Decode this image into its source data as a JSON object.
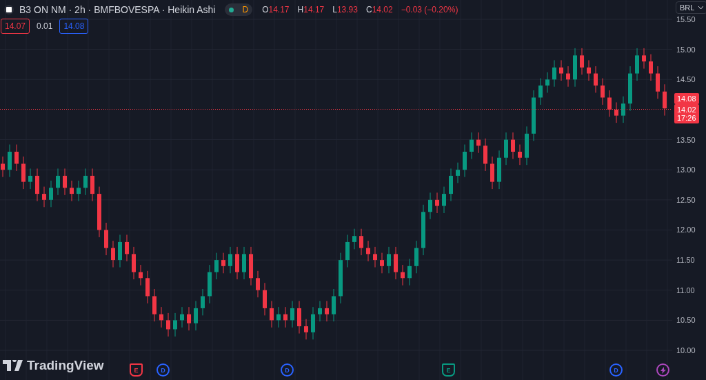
{
  "header": {
    "title": "B3 ON NM · 2h · BMFBOVESPA · Heikin Ashi",
    "timeframe_badge": "D",
    "ohlc": [
      {
        "label": "O",
        "value": "14.17"
      },
      {
        "label": "H",
        "value": "14.17"
      },
      {
        "label": "L",
        "value": "13.93"
      },
      {
        "label": "C",
        "value": "14.02"
      }
    ],
    "change": "−0.03 (−0.20%)"
  },
  "quote": {
    "bid": "14.07",
    "spread": "0.01",
    "ask": "14.08"
  },
  "currency": "BRL",
  "price_axis": {
    "ask_label": "14.08",
    "last_price": "14.02",
    "countdown": "17:26"
  },
  "chart_data": {
    "type": "candlestick",
    "ylim": [
      10,
      15.5
    ],
    "grid": true,
    "yticks": [
      {
        "value": 10,
        "label": "10.00"
      },
      {
        "value": 10.5,
        "label": "10.50"
      },
      {
        "value": 11,
        "label": "11.00"
      },
      {
        "value": 11.5,
        "label": "11.50"
      },
      {
        "value": 12,
        "label": "12.00"
      },
      {
        "value": 12.5,
        "label": "12.50"
      },
      {
        "value": 13,
        "label": "13.00"
      },
      {
        "value": 13.5,
        "label": "13.50"
      },
      {
        "value": 14.5,
        "label": "14.50"
      },
      {
        "value": 15,
        "label": "15.00"
      },
      {
        "value": 15.5,
        "label": "15.50"
      }
    ],
    "ohlc": [
      [
        13.1,
        13.22,
        12.88,
        13.0
      ],
      [
        13.0,
        13.42,
        12.88,
        13.3
      ],
      [
        13.3,
        13.42,
        12.98,
        13.1
      ],
      [
        13.1,
        13.22,
        12.68,
        12.8
      ],
      [
        12.8,
        13.02,
        12.68,
        12.9
      ],
      [
        12.9,
        13.02,
        12.48,
        12.6
      ],
      [
        12.6,
        12.72,
        12.38,
        12.5
      ],
      [
        12.5,
        12.82,
        12.38,
        12.7
      ],
      [
        12.7,
        13.02,
        12.58,
        12.9
      ],
      [
        12.9,
        13.02,
        12.58,
        12.7
      ],
      [
        12.7,
        12.82,
        12.48,
        12.6
      ],
      [
        12.6,
        12.82,
        12.48,
        12.7
      ],
      [
        12.7,
        13.02,
        12.58,
        12.9
      ],
      [
        12.9,
        13.02,
        12.48,
        12.6
      ],
      [
        12.6,
        12.72,
        11.88,
        12.0
      ],
      [
        12.0,
        12.12,
        11.58,
        11.7
      ],
      [
        11.7,
        11.82,
        11.38,
        11.5
      ],
      [
        11.5,
        11.92,
        11.38,
        11.8
      ],
      [
        11.8,
        11.92,
        11.48,
        11.6
      ],
      [
        11.6,
        11.72,
        11.18,
        11.3
      ],
      [
        11.3,
        11.42,
        11.08,
        11.2
      ],
      [
        11.2,
        11.32,
        10.78,
        10.9
      ],
      [
        10.9,
        11.02,
        10.48,
        10.6
      ],
      [
        10.6,
        10.72,
        10.38,
        10.5
      ],
      [
        10.5,
        10.62,
        10.23,
        10.35
      ],
      [
        10.35,
        10.62,
        10.23,
        10.5
      ],
      [
        10.5,
        10.72,
        10.38,
        10.6
      ],
      [
        10.6,
        10.72,
        10.33,
        10.45
      ],
      [
        10.45,
        10.82,
        10.33,
        10.7
      ],
      [
        10.7,
        11.02,
        10.58,
        10.9
      ],
      [
        10.9,
        11.42,
        10.78,
        11.3
      ],
      [
        11.3,
        11.62,
        11.18,
        11.5
      ],
      [
        11.5,
        11.62,
        11.28,
        11.4
      ],
      [
        11.4,
        11.72,
        11.28,
        11.6
      ],
      [
        11.6,
        11.72,
        11.18,
        11.3
      ],
      [
        11.3,
        11.72,
        11.18,
        11.6
      ],
      [
        11.6,
        11.72,
        11.08,
        11.2
      ],
      [
        11.2,
        11.32,
        10.88,
        11.0
      ],
      [
        11.0,
        11.12,
        10.58,
        10.7
      ],
      [
        10.7,
        10.82,
        10.38,
        10.5
      ],
      [
        10.5,
        10.72,
        10.38,
        10.6
      ],
      [
        10.6,
        10.72,
        10.38,
        10.5
      ],
      [
        10.5,
        10.82,
        10.38,
        10.7
      ],
      [
        10.7,
        10.82,
        10.28,
        10.4
      ],
      [
        10.4,
        10.52,
        10.18,
        10.3
      ],
      [
        10.3,
        10.72,
        10.18,
        10.6
      ],
      [
        10.6,
        10.82,
        10.48,
        10.7
      ],
      [
        10.7,
        10.82,
        10.48,
        10.6
      ],
      [
        10.6,
        11.02,
        10.48,
        10.9
      ],
      [
        10.9,
        11.62,
        10.78,
        11.5
      ],
      [
        11.5,
        11.92,
        11.38,
        11.8
      ],
      [
        11.8,
        12.02,
        11.68,
        11.9
      ],
      [
        11.9,
        12.02,
        11.58,
        11.7
      ],
      [
        11.7,
        11.82,
        11.48,
        11.6
      ],
      [
        11.6,
        11.72,
        11.38,
        11.5
      ],
      [
        11.5,
        11.62,
        11.28,
        11.4
      ],
      [
        11.4,
        11.72,
        11.28,
        11.6
      ],
      [
        11.6,
        11.72,
        11.18,
        11.3
      ],
      [
        11.3,
        11.42,
        11.08,
        11.2
      ],
      [
        11.2,
        11.52,
        11.08,
        11.4
      ],
      [
        11.4,
        11.82,
        11.28,
        11.7
      ],
      [
        11.7,
        12.42,
        11.58,
        12.3
      ],
      [
        12.3,
        12.62,
        12.18,
        12.5
      ],
      [
        12.5,
        12.62,
        12.28,
        12.4
      ],
      [
        12.4,
        12.72,
        12.28,
        12.6
      ],
      [
        12.6,
        13.02,
        12.48,
        12.9
      ],
      [
        12.9,
        13.12,
        12.78,
        13.0
      ],
      [
        13.0,
        13.42,
        12.88,
        13.3
      ],
      [
        13.3,
        13.62,
        13.18,
        13.5
      ],
      [
        13.5,
        13.62,
        13.28,
        13.4
      ],
      [
        13.4,
        13.52,
        12.98,
        13.1
      ],
      [
        13.1,
        13.22,
        12.68,
        12.8
      ],
      [
        12.8,
        13.32,
        12.68,
        13.2
      ],
      [
        13.2,
        13.62,
        13.08,
        13.5
      ],
      [
        13.5,
        13.62,
        13.18,
        13.3
      ],
      [
        13.3,
        13.42,
        13.08,
        13.2
      ],
      [
        13.2,
        13.72,
        13.08,
        13.6
      ],
      [
        13.6,
        14.32,
        13.48,
        14.2
      ],
      [
        14.2,
        14.52,
        14.08,
        14.4
      ],
      [
        14.4,
        14.62,
        14.28,
        14.5
      ],
      [
        14.5,
        14.82,
        14.38,
        14.7
      ],
      [
        14.7,
        14.82,
        14.48,
        14.6
      ],
      [
        14.6,
        14.72,
        14.38,
        14.5
      ],
      [
        14.5,
        15.02,
        14.38,
        14.9
      ],
      [
        14.9,
        15.02,
        14.58,
        14.7
      ],
      [
        14.7,
        14.82,
        14.48,
        14.6
      ],
      [
        14.6,
        14.72,
        14.28,
        14.4
      ],
      [
        14.4,
        14.52,
        14.08,
        14.2
      ],
      [
        14.2,
        14.32,
        13.88,
        14.0
      ],
      [
        14.0,
        14.12,
        13.78,
        13.9
      ],
      [
        13.9,
        14.22,
        13.78,
        14.1
      ],
      [
        14.1,
        14.72,
        13.98,
        14.6
      ],
      [
        14.6,
        15.02,
        14.48,
        14.9
      ],
      [
        14.9,
        15.02,
        14.68,
        14.8
      ],
      [
        14.8,
        14.92,
        14.48,
        14.6
      ],
      [
        14.6,
        14.72,
        14.18,
        14.3
      ],
      [
        14.3,
        14.42,
        13.9,
        14.02
      ]
    ]
  },
  "events": [
    {
      "kind": "earnings",
      "label": "E",
      "color": "#f23645"
    },
    {
      "kind": "dividend",
      "label": "D",
      "color": "#2962ff"
    },
    {
      "kind": "dividend",
      "label": "D",
      "color": "#2962ff"
    },
    {
      "kind": "earnings",
      "label": "E",
      "color": "#089981"
    },
    {
      "kind": "dividend",
      "label": "D",
      "color": "#2962ff"
    },
    {
      "kind": "flash",
      "color": "#ab47bc"
    }
  ],
  "brand": "TradingView"
}
